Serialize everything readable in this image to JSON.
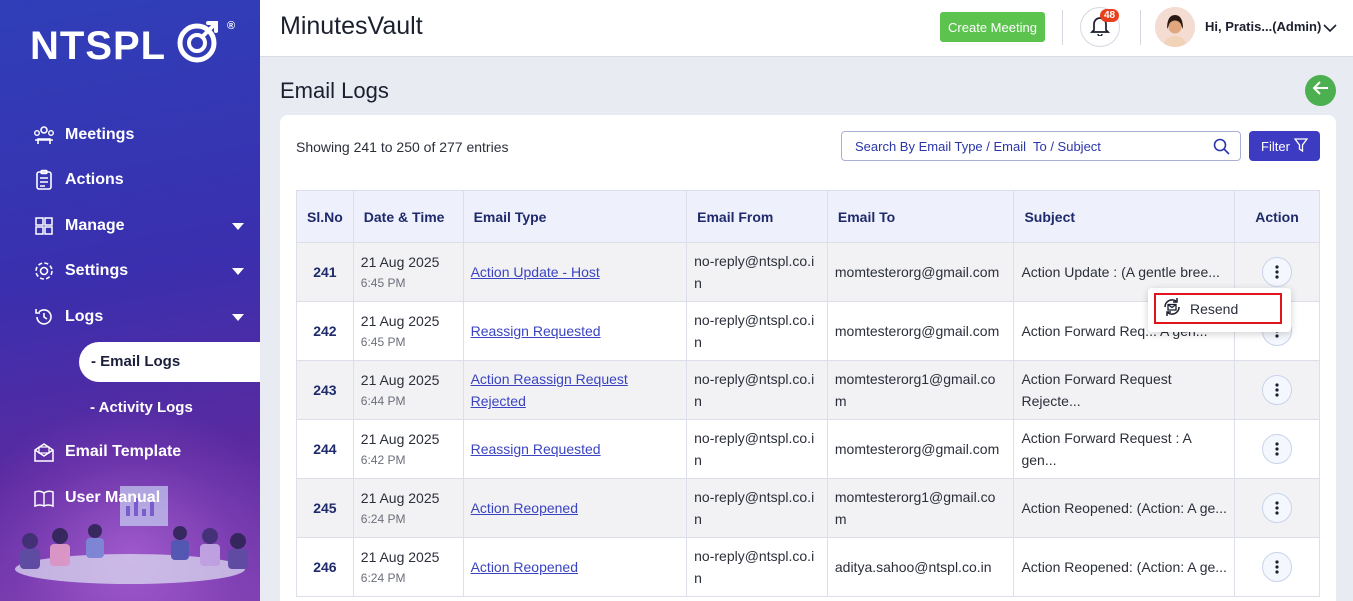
{
  "brand": {
    "logo_text": "NTSPL",
    "registered": "®"
  },
  "app_title": "MinutesVault",
  "header": {
    "create_button": "Create Meeting",
    "notification_count": "48",
    "user_greeting": "Hi, Pratis...(Admin)"
  },
  "sidebar": {
    "items": [
      {
        "label": "Meetings",
        "icon": "meetings-icon"
      },
      {
        "label": "Actions",
        "icon": "clipboard-icon"
      },
      {
        "label": "Manage",
        "icon": "grid-icon"
      },
      {
        "label": "Settings",
        "icon": "gear-icon"
      },
      {
        "label": "Logs",
        "icon": "history-icon"
      }
    ],
    "sub_items": [
      {
        "label": "- Email Logs",
        "active": true
      },
      {
        "label": "- Activity Logs",
        "active": false
      }
    ],
    "bottom_items": [
      {
        "label": "Email Template",
        "icon": "mail-template-icon"
      },
      {
        "label": "User Manual",
        "icon": "book-icon"
      }
    ]
  },
  "page": {
    "title": "Email Logs",
    "showing": "Showing 241 to 250 of 277 entries",
    "search_placeholder": "Search By Email Type / Email  To / Subject",
    "filter_label": "Filter"
  },
  "table": {
    "headers": [
      "Sl.No",
      "Date & Time",
      "Email Type",
      "Email From",
      "Email To",
      "Subject",
      "Action"
    ],
    "rows": [
      {
        "sl": "241",
        "date": "21 Aug 2025",
        "time": "6:45 PM",
        "type": "Action Update - Host",
        "from": "no-reply@ntspl.co.in",
        "to": "momtesterorg@gmail.com",
        "subject": "Action Update : (A gentle bree..."
      },
      {
        "sl": "242",
        "date": "21 Aug 2025",
        "time": "6:45 PM",
        "type": "Reassign Requested",
        "from": "no-reply@ntspl.co.in",
        "to": "momtesterorg@gmail.com",
        "subject": "Action Forward Req... A gen..."
      },
      {
        "sl": "243",
        "date": "21 Aug 2025",
        "time": "6:44 PM",
        "type": "Action Reassign Request Rejected",
        "from": "no-reply@ntspl.co.in",
        "to": "momtesterorg1@gmail.com",
        "subject": "Action Forward Request Rejecte..."
      },
      {
        "sl": "244",
        "date": "21 Aug 2025",
        "time": "6:42 PM",
        "type": "Reassign Requested",
        "from": "no-reply@ntspl.co.in",
        "to": "momtesterorg@gmail.com",
        "subject": "Action Forward Request : A gen..."
      },
      {
        "sl": "245",
        "date": "21 Aug 2025",
        "time": "6:24 PM",
        "type": "Action Reopened",
        "from": "no-reply@ntspl.co.in",
        "to": "momtesterorg1@gmail.com",
        "subject": "Action Reopened: (Action: A ge..."
      },
      {
        "sl": "246",
        "date": "21 Aug 2025",
        "time": "6:24 PM",
        "type": "Action Reopened",
        "from": "no-reply@ntspl.co.in",
        "to": "aditya.sahoo@ntspl.co.in",
        "subject": "Action Reopened: (Action: A ge..."
      }
    ]
  },
  "popup": {
    "resend_label": "Resend"
  },
  "colors": {
    "accent": "#3d3bc1",
    "create": "#5cc34f",
    "back": "#4caf50",
    "highlight": "#e0151b"
  }
}
